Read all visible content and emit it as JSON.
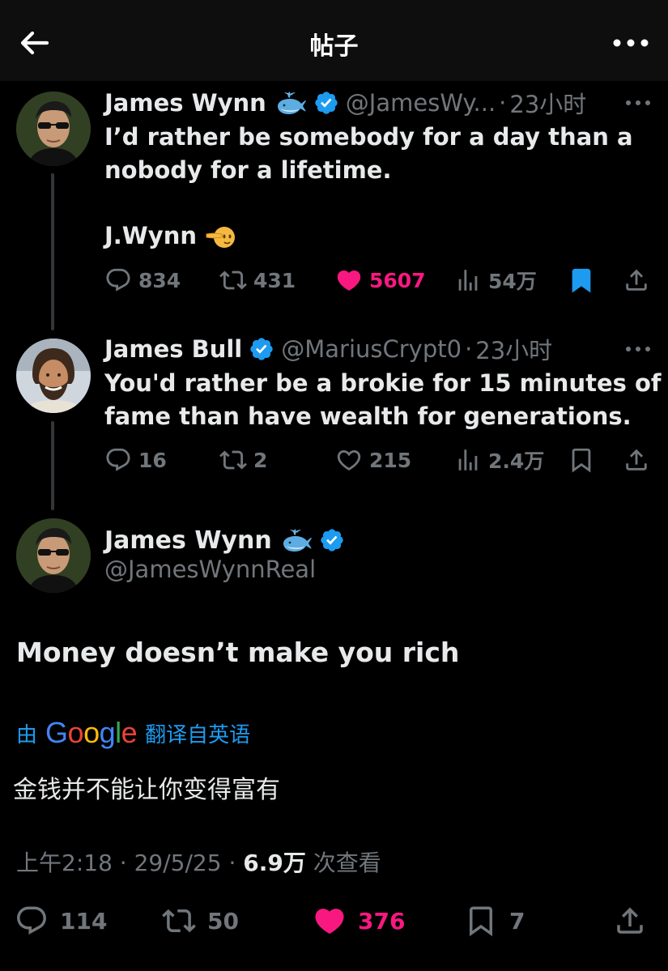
{
  "header": {
    "title": "帖子"
  },
  "tweets": [
    {
      "display_name": "James Wynn",
      "name_emoji": "whale-emoji",
      "handle": "@JamesWy...",
      "sep": "·",
      "time": "23小时",
      "text_lines": [
        "I’d rather be somebody for a day than a",
        "nobody for a lifetime."
      ],
      "sign_off": "J.Wynn",
      "sign_emoji": "salute-emoji",
      "actions": {
        "replies": "834",
        "reposts": "431",
        "likes": "5607",
        "views": "54万"
      }
    },
    {
      "display_name": "James Bull",
      "handle": "@MariusCrypt0",
      "sep": "·",
      "time": "23小时",
      "text_lines": [
        "You'd rather be a brokie for 15 minutes of",
        "fame than have wealth for generations."
      ],
      "actions": {
        "replies": "16",
        "reposts": "2",
        "likes": "215",
        "views": "2.4万"
      }
    }
  ],
  "main": {
    "display_name": "James Wynn",
    "handle": "@JamesWynnReal",
    "text": "Money doesn’t make you rich",
    "translate_prefix": "由",
    "translate_brand": "Google",
    "translate_suffix": "翻译自英语",
    "translated_text": "金钱并不能让你变得富有",
    "time": "上午2:18",
    "sep1": "·",
    "date": "29/5/25",
    "sep2": "·",
    "views": "6.9万",
    "views_label": "次查看",
    "actions": {
      "replies": "114",
      "reposts": "50",
      "likes": "376",
      "bookmarks": "7"
    }
  },
  "colors": {
    "background": "#000000",
    "accent": "#1d9bf0",
    "like": "#f91880",
    "muted": "#71767b",
    "text": "#e7e9ea"
  }
}
